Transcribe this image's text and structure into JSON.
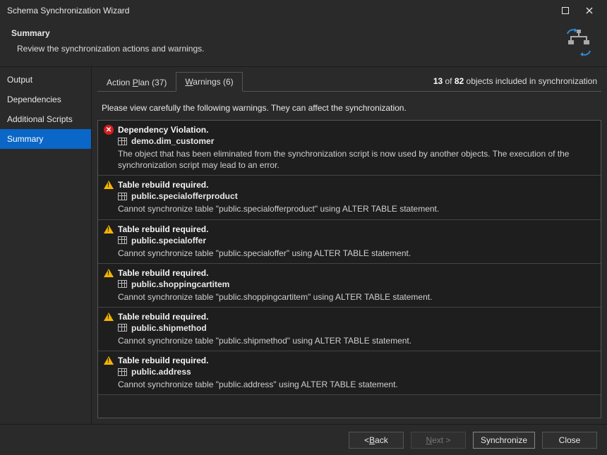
{
  "window": {
    "title": "Schema Synchronization Wizard"
  },
  "header": {
    "title": "Summary",
    "subtitle": "Review the synchronization actions and warnings."
  },
  "sidebar": {
    "items": [
      {
        "label": "Output"
      },
      {
        "label": "Dependencies"
      },
      {
        "label": "Additional Scripts"
      },
      {
        "label": "Summary"
      }
    ],
    "selected_index": 3
  },
  "tabs": {
    "action_plan": {
      "prefix": "Action ",
      "hotkey": "P",
      "rest": "lan (37)"
    },
    "warnings": {
      "hotkey": "W",
      "rest": "arnings (6)"
    },
    "status": {
      "count": "13",
      "total": "82",
      "text_mid": " of ",
      "text_tail": " objects included in synchronization"
    }
  },
  "intro": "Please view carefully the following warnings. They can affect the synchronization.",
  "warnings": [
    {
      "type": "error",
      "title": "Dependency Violation.",
      "object": "demo.dim_customer",
      "message": "The object that has been eliminated from the synchronization script is now used by another objects. The execution of the synchronization script may lead to an error."
    },
    {
      "type": "warn",
      "title": "Table rebuild required.",
      "object": "public.specialofferproduct",
      "message": "Cannot synchronize table \"public.specialofferproduct\" using ALTER TABLE statement."
    },
    {
      "type": "warn",
      "title": "Table rebuild required.",
      "object": "public.specialoffer",
      "message": "Cannot synchronize table \"public.specialoffer\" using ALTER TABLE statement."
    },
    {
      "type": "warn",
      "title": "Table rebuild required.",
      "object": "public.shoppingcartitem",
      "message": "Cannot synchronize table \"public.shoppingcartitem\" using ALTER TABLE statement."
    },
    {
      "type": "warn",
      "title": "Table rebuild required.",
      "object": "public.shipmethod",
      "message": "Cannot synchronize table \"public.shipmethod\" using ALTER TABLE statement."
    },
    {
      "type": "warn",
      "title": "Table rebuild required.",
      "object": "public.address",
      "message": "Cannot synchronize table \"public.address\" using ALTER TABLE statement."
    }
  ],
  "footer": {
    "back": {
      "lt": "< ",
      "hotkey": "B",
      "rest": "ack"
    },
    "next": {
      "hotkey": "N",
      "rest": "ext >"
    },
    "sync": "Synchronize",
    "close": "Close"
  }
}
